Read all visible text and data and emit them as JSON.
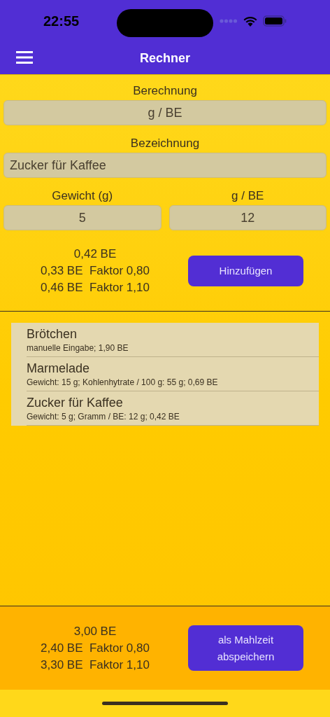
{
  "status_bar": {
    "time": "22:55"
  },
  "nav": {
    "title": "Rechner"
  },
  "form": {
    "calc_label": "Berechnung",
    "calc_value": "g / BE",
    "name_label": "Bezeichnung",
    "name_value": "Zucker für Kaffee",
    "weight_label": "Gewicht (g)",
    "weight_value": "5",
    "ratio_label": "g / BE",
    "ratio_value": "12"
  },
  "result": {
    "total": "0,42 BE",
    "lines": [
      "0,33 BE  Faktor 0,80",
      "0,46 BE  Faktor 1,10"
    ],
    "button": "Hinzufügen"
  },
  "items": [
    {
      "title": "Brötchen",
      "detail": "manuelle Eingabe; 1,90 BE"
    },
    {
      "title": "Marmelade",
      "detail": "Gewicht: 15 g; Kohlenhytrate / 100 g: 55 g; 0,69 BE"
    },
    {
      "title": "Zucker für Kaffee",
      "detail": "Gewicht: 5 g; Gramm / BE: 12 g; 0,42 BE"
    }
  ],
  "summary": {
    "total": "3,00 BE",
    "lines": [
      "2,40 BE  Faktor 0,80",
      "3,30 BE  Faktor 1,10"
    ],
    "button": "als Mahlzeit abspeichern"
  }
}
